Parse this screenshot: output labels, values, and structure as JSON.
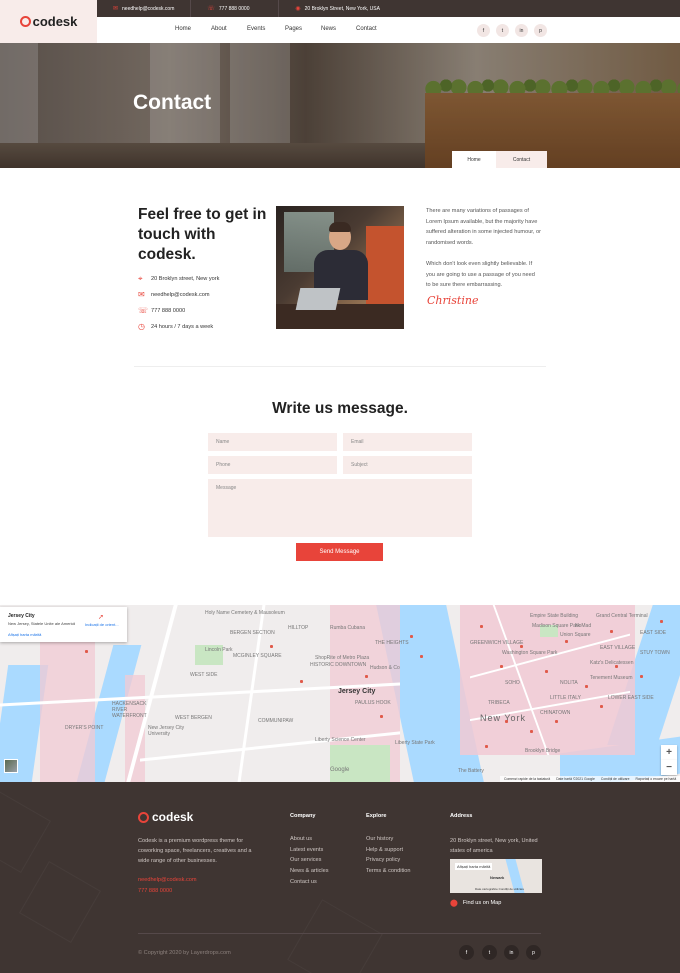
{
  "header": {
    "logo": "codesk",
    "topbar": {
      "email": "needhelp@codesk.com",
      "phone": "777 888 0000",
      "address": "20 Broklyn Street, New York, USA"
    },
    "nav": [
      "Home",
      "About",
      "Events",
      "Pages",
      "News",
      "Contact"
    ],
    "social": [
      "f",
      "t",
      "in",
      "p"
    ]
  },
  "hero": {
    "title": "Contact",
    "breadcrumb": [
      "Home",
      "Contact"
    ]
  },
  "intro": {
    "heading": "Feel free to get in touch with codesk.",
    "address": "20 Broklyn street, New york",
    "email": "needhelp@codesk.com",
    "phone": "777 888 0000",
    "hours": "24 hours / 7 days a week",
    "para1": "There are many variations of passages of Lorem Ipsum available, but the majority have suffered alteration in some injected humour, or randomised words.",
    "para2": "Which don't look even slightly believable. If you are going to use a passage of you need to be sure there embarrassing.",
    "signature": "Christine"
  },
  "form": {
    "title": "Write us message.",
    "name_placeholder": "Name",
    "email_placeholder": "Email",
    "phone_placeholder": "Phone",
    "subject_placeholder": "Subject",
    "message_placeholder": "Message",
    "submit": "Send Message"
  },
  "map": {
    "card_title": "Jersey City",
    "card_subtitle": "New Jersey, Statele Unite ale Americii",
    "card_directions": "Indicații de orient...",
    "card_larger": "Afișați harta mărită",
    "labels": [
      "Holy Name Cemetery & Mausoleum",
      "BERGEN SECTION",
      "HILLTOP",
      "Rumba Cubana",
      "THE HEIGHTS",
      "Lincoln Park",
      "MCGINLEY SQUARE",
      "WEST SIDE",
      "HISTORIC DOWNTOWN",
      "Hudson & Co",
      "ShopRite of Metro Plaza",
      "PAULUS HOOK",
      "HACKENSACK RIVER WATERFRONT",
      "WEST BERGEN",
      "COMMUNIPAW",
      "DRYER'S POINT",
      "New Jersey City University",
      "Liberty Science Center",
      "Liberty State Park",
      "Empire State Building",
      "Madison Square Park",
      "Grand Central Terminal",
      "Washington Square Park",
      "Katz's Delicatessen",
      "Tenement Museum",
      "LOWER EAST SIDE",
      "EAST VILLAGE",
      "SOHO",
      "TRIBECA",
      "Brooklyn Bridge",
      "The Battery",
      "Google",
      "GREENWICH VILLAGE",
      "Union Square",
      "NoMad",
      "EAST SIDE",
      "STUY TOWN",
      "LITTLE ITALY",
      "CHINATOWN",
      "NOLITA"
    ],
    "city_main": "Jersey City",
    "city_ny": "New York",
    "footer_items": [
      "Comenzi rapide de la tastatură",
      "Date hartă ©2021 Google",
      "Condiții de utilizare",
      "Raportați o eroare pe hartă"
    ],
    "zoom_in": "+",
    "zoom_out": "−"
  },
  "footer": {
    "logo": "codesk",
    "about": "Codesk is a premium wordpress theme for coworking space, freelancers, creatives and a wide range of other businesses.",
    "email": "needhelp@codesk.com",
    "phone": "777 888 0000",
    "company_title": "Company",
    "company_links": [
      "About us",
      "Latest events",
      "Our services",
      "News & articles",
      "Contact us"
    ],
    "explore_title": "Explore",
    "explore_links": [
      "Our history",
      "Help & support",
      "Privacy policy",
      "Terms & condition"
    ],
    "address_title": "Address",
    "address": "20 Broklyn street, New york, United states of america",
    "mini_map_larger": "Afișați harta mărită",
    "mini_map_city": "Newark",
    "mini_map_footer": "Date cartografice   Condiții de utilizare",
    "find_map": "Find us on Map",
    "copyright": "© Copyright 2020 by Layerdrops.com",
    "social": [
      "f",
      "t",
      "in",
      "p"
    ]
  },
  "colors": {
    "accent": "#e8443a",
    "dark": "#3f3532",
    "soft": "#f8ecea"
  }
}
